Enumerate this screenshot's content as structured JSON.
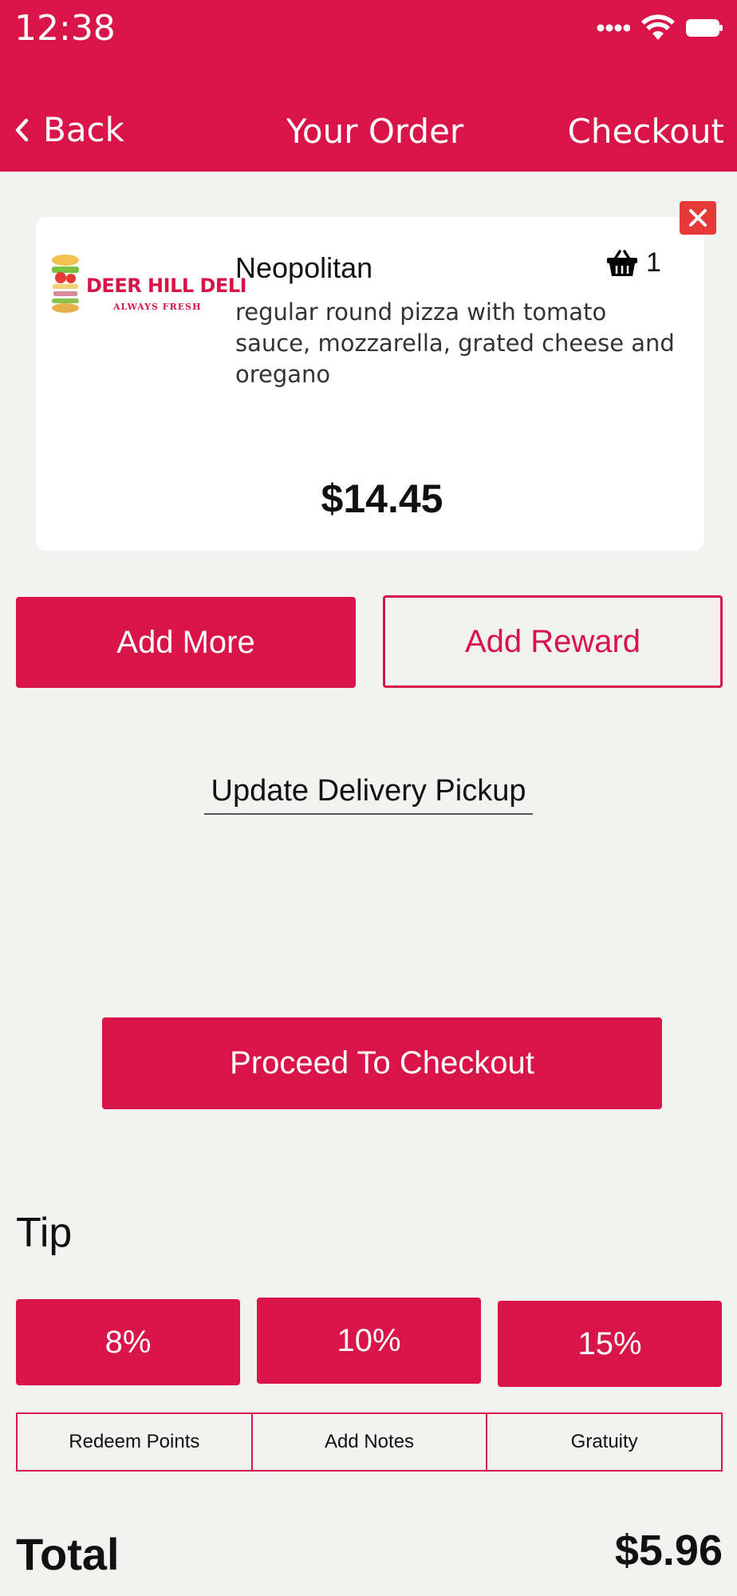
{
  "status_bar": {
    "time": "12:38"
  },
  "nav": {
    "back_label": "Back",
    "title": "Your Order",
    "checkout_label": "Checkout"
  },
  "cart_item": {
    "brand_name": "DEER HILL DELI",
    "brand_tagline": "ALWAYS FRESH",
    "name": "Neopolitan",
    "description": "regular round pizza with tomato sauce, mozzarella, grated cheese and oregano",
    "quantity": "1",
    "price": "$14.45"
  },
  "buttons": {
    "add_more": "Add More",
    "add_reward": "Add Reward",
    "update_delivery": "Update Delivery Pickup",
    "proceed_checkout": "Proceed To Checkout"
  },
  "tip": {
    "heading": "Tip",
    "options": [
      "8%",
      "10%",
      "15%"
    ]
  },
  "actions": [
    "Redeem Points",
    "Add Notes",
    "Gratuity"
  ],
  "total": {
    "label": "Total",
    "value": "$5.96"
  },
  "colors": {
    "primary": "#d81448",
    "background": "#f2f2f0",
    "remove": "#e63a3a"
  }
}
